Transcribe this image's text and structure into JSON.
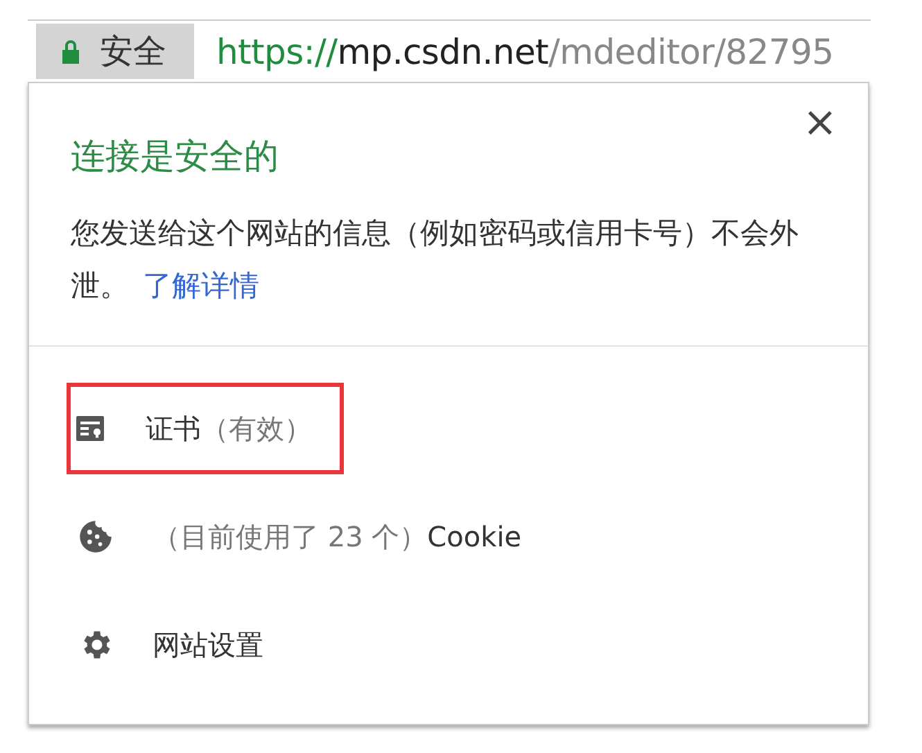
{
  "address_bar": {
    "security_label": "安全",
    "url": [
      {
        "kind": "scheme",
        "text": "https://"
      },
      {
        "kind": "host",
        "text": "mp.csdn.net"
      },
      {
        "kind": "path",
        "text": "/mdeditor/82795"
      }
    ]
  },
  "popup": {
    "close": "×",
    "title": "连接是安全的",
    "description": "您发送给这个网站的信息（例如密码或信用卡号）不会外泄。",
    "link": "了解详情",
    "items": [
      {
        "kind": "certificate",
        "highlighted": true,
        "parts": [
          {
            "text": "证书",
            "muted": false
          },
          {
            "text": "（有效）",
            "muted": true
          }
        ]
      },
      {
        "kind": "cookie",
        "highlighted": false,
        "parts": [
          {
            "text": "（目前使用了 23 个）",
            "muted": true
          },
          {
            "text": "Cookie",
            "muted": false
          }
        ]
      },
      {
        "kind": "settings",
        "highlighted": false,
        "parts": [
          {
            "text": "网站设置",
            "muted": false
          }
        ]
      }
    ]
  }
}
